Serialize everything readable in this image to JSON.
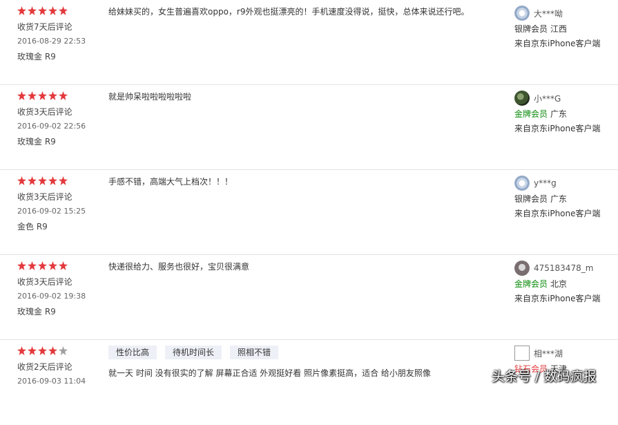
{
  "colors": {
    "star_on": "#e4393c",
    "star_off": "#a0a0a0",
    "gold_level": "#0a8a0a",
    "diamond_level": "#e4393c",
    "tag_bg": "#eef0f7",
    "divider": "#e2e2e2"
  },
  "reviews": [
    {
      "rating": 5,
      "delay": "收货7天后评论",
      "date": "2016-08-29 22:53",
      "variant": "玫瑰金 R9",
      "tags": [],
      "comment": "给妹妹买的，女生普遍喜欢oppo，r9外观也挺漂亮的！手机速度没得说，挺快，总体来说还行吧。",
      "user": {
        "avatar": "silver-default-avatar",
        "name": "大***呦",
        "level": "银牌会员",
        "region": "江西",
        "source": "来自京东iPhone客户端"
      }
    },
    {
      "rating": 5,
      "delay": "收货3天后评论",
      "date": "2016-09-02 22:56",
      "variant": "玫瑰金 R9",
      "tags": [],
      "comment": "就是帅呆啦啦啦啦啦啦",
      "user": {
        "avatar": "photo-avatar",
        "name": "小***G",
        "level": "金牌会员",
        "region": "广东",
        "source": "来自京东iPhone客户端"
      }
    },
    {
      "rating": 5,
      "delay": "收货3天后评论",
      "date": "2016-09-02 15:25",
      "variant": "金色 R9",
      "tags": [],
      "comment": "手感不错，高端大气上档次！！！",
      "user": {
        "avatar": "silver-default-avatar",
        "name": "y***g",
        "level": "银牌会员",
        "region": "广东",
        "source": "来自京东iPhone客户端"
      }
    },
    {
      "rating": 5,
      "delay": "收货3天后评论",
      "date": "2016-09-02 19:38",
      "variant": "玫瑰金 R9",
      "tags": [],
      "comment": "快递很给力、服务也很好，宝贝很满意",
      "user": {
        "avatar": "photo-avatar",
        "name": "475183478_m",
        "level": "金牌会员",
        "region": "北京",
        "source": "来自京东iPhone客户端"
      }
    },
    {
      "rating": 4,
      "delay": "收货2天后评论",
      "date": "2016-09-03 11:04",
      "variant": "",
      "tags": [
        "性价比高",
        "待机时间长",
        "照相不错"
      ],
      "comment": "就一天 时间 没有很实的了解 屏幕正合适 外观挺好看 照片像素挺高，适合 给小朋友照像",
      "user": {
        "avatar": "broken-image-avatar",
        "name": "相***湖",
        "level": "钻石会员",
        "region": "天津",
        "source": ""
      }
    }
  ],
  "watermark": "头条号 / 数码疯报"
}
